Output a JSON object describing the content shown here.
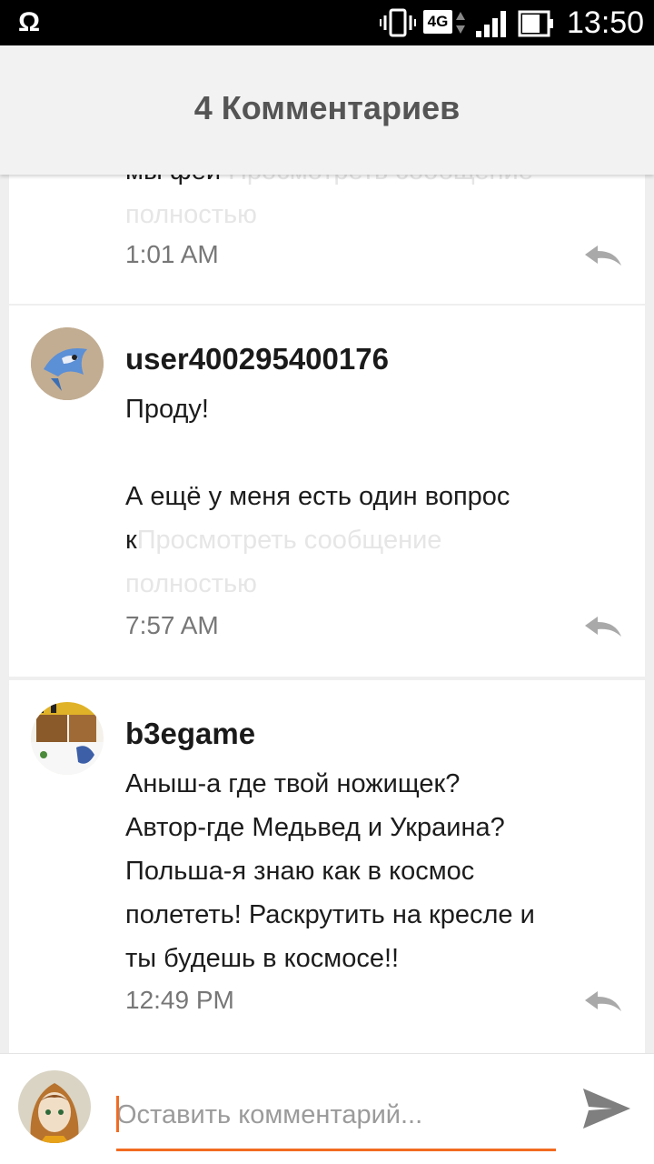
{
  "status_bar": {
    "network": "4G",
    "time": "13:50"
  },
  "header": {
    "title": "4 Комментариев"
  },
  "comments": [
    {
      "partial_top_line": "мы фей",
      "text_more_tail": "полностью",
      "time": "1:01 AM"
    },
    {
      "username": "user400295400176",
      "text_lines": [
        "Проду!",
        "",
        "А ещё у меня есть один вопрос"
      ],
      "text_last": "к",
      "more_label": "Просмотреть сообщение",
      "more_label_2": "полностью",
      "time": "7:57 AM"
    },
    {
      "username": "b3egame",
      "text_lines": [
        "Аныш-а где твой ножищек?",
        "Автор-где Медьвед и Украина?",
        "Польша-я знаю как в космос",
        "полететь! Раскрутить на кресле и",
        "ты будешь в космосе!!"
      ],
      "time": "12:49 PM"
    }
  ],
  "composer": {
    "placeholder": "Оставить комментарий..."
  },
  "colors": {
    "accent": "#f26b21",
    "header_bg": "#f2f2f2",
    "page_bg": "#efefef"
  },
  "icons": [
    "omega-icon",
    "vibrate-icon",
    "signal-icon",
    "battery-icon",
    "reply-icon",
    "send-icon"
  ]
}
